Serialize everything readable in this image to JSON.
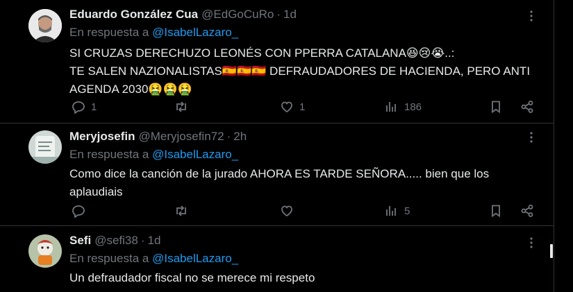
{
  "tweets": [
    {
      "name": "Eduardo González Cua",
      "handle": "@EdGoCuRo",
      "time": "1d",
      "reply_prefix": "En respuesta a",
      "reply_mention": "@IsabelLazaro_",
      "text_line1": "SI CRUZAS DERECHUZO LEONÉS CON PPERRA CATALANA",
      "emoji_line1": "😆😢😭",
      "text_line1_end": "..:",
      "text_line2": "TE SALEN NAZIONALISTAS",
      "emoji_line2": "🇪🇸🇪🇸🇪🇸",
      "text_line2_end": " DEFRAUDADORES DE HACIENDA, PERO ANTI",
      "text_line3": "AGENDA 2030",
      "emoji_line3": "🤮🤮🤮",
      "replies": "1",
      "reposts": "",
      "likes": "1",
      "views": "186"
    },
    {
      "name": "Meryjosefin",
      "handle": "@Meryjosefin72",
      "time": "2h",
      "reply_prefix": "En respuesta a",
      "reply_mention": "@IsabelLazaro_",
      "text_line1": "Como dice la canción de la jurado AHORA ES TARDE SEÑORA..... bien que los",
      "text_line2": "aplaudiais",
      "replies": "",
      "reposts": "",
      "likes": "",
      "views": "5"
    },
    {
      "name": "Sefi",
      "handle": "@sefi38",
      "time": "1d",
      "reply_prefix": "En respuesta a",
      "reply_mention": "@IsabelLazaro_",
      "text_line1": "Un defraudador fiscal no se merece mi respeto"
    }
  ],
  "icons": {
    "reply": "reply-icon",
    "repost": "repost-icon",
    "like": "heart-icon",
    "views": "views-icon",
    "bookmark": "bookmark-icon",
    "share": "share-icon",
    "more": "more-icon"
  },
  "colors": {
    "background": "#000000",
    "text": "#e7e9ea",
    "muted": "#71767b",
    "link": "#1d9bf0",
    "divider": "#2f3336"
  }
}
